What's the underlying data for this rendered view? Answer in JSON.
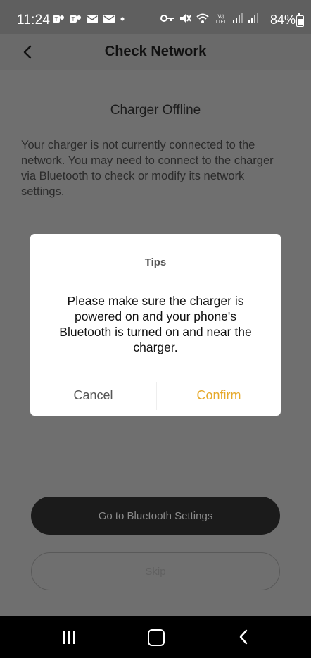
{
  "status_bar": {
    "time": "11:24",
    "battery_text": "84%"
  },
  "header": {
    "title": "Check Network"
  },
  "main": {
    "offline_title": "Charger Offline",
    "offline_text": "Your charger is not currently connected to the network. You may need to connect to the charger via Bluetooth to check or modify its network settings.",
    "bt_button": "Go to Bluetooth Settings",
    "skip_button": "Skip"
  },
  "dialog": {
    "title": "Tips",
    "message": "Please make sure the charger is powered on and your phone's Bluetooth is turned on and near the charger.",
    "cancel": "Cancel",
    "confirm": "Confirm"
  },
  "colors": {
    "confirm_accent": "#e6a92a",
    "overlay": "#6f6f6f",
    "primary_button": "#1b1b1b"
  },
  "icons": [
    "teams-icon",
    "mail-icon",
    "key-icon",
    "mute-icon",
    "wifi-icon",
    "signal-icon",
    "battery-icon",
    "chevron-left-icon",
    "recent-apps-icon",
    "home-icon",
    "back-icon"
  ]
}
